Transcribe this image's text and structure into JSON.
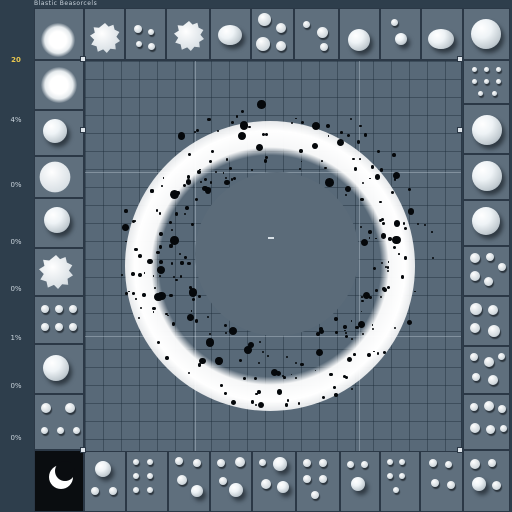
{
  "window": {
    "title": "Blastic Beasorcels"
  },
  "row_labels": [
    "20",
    "4%",
    "0%",
    "0%",
    "0%",
    "1%",
    "0%",
    "0%"
  ],
  "row_label_accent_index": 0,
  "canvas": {
    "name": "sphere-halo-preview"
  },
  "colors": {
    "accent": "#e7c64f",
    "tile": "#5f6f7d",
    "canvas": "#586978",
    "background": "#2e3e4c"
  },
  "icons": [
    "fuzzy-ball-icon",
    "splat-ball-icon",
    "dots-icon",
    "sphere-icon",
    "crescent-icon"
  ]
}
